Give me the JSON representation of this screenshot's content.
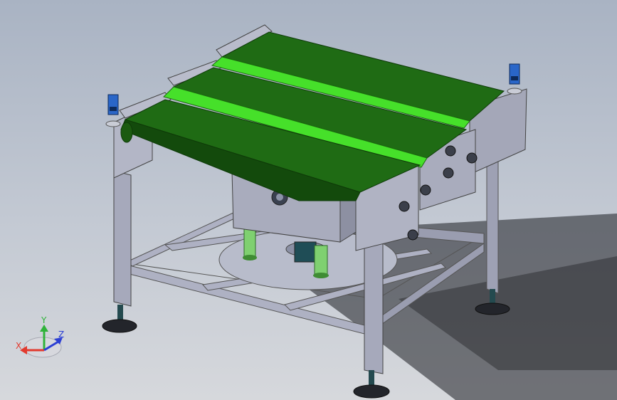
{
  "viewport": {
    "background_top": "#a9b3c3",
    "background_bottom": "#d6d8dc"
  },
  "colors": {
    "belt": "#1f6b14",
    "belt_shadow": "#134a0c",
    "belt_gap": "#46e02a",
    "frame": "#a6a9bb",
    "frame_dark": "#6f7285",
    "sensor": "#2a66c8",
    "spring": "#7fd070"
  },
  "triad": {
    "x_label": "X",
    "y_label": "Y",
    "z_label": "Z",
    "x_color": "#e23a2e",
    "y_color": "#2fb33a",
    "z_color": "#2c3fd4"
  }
}
